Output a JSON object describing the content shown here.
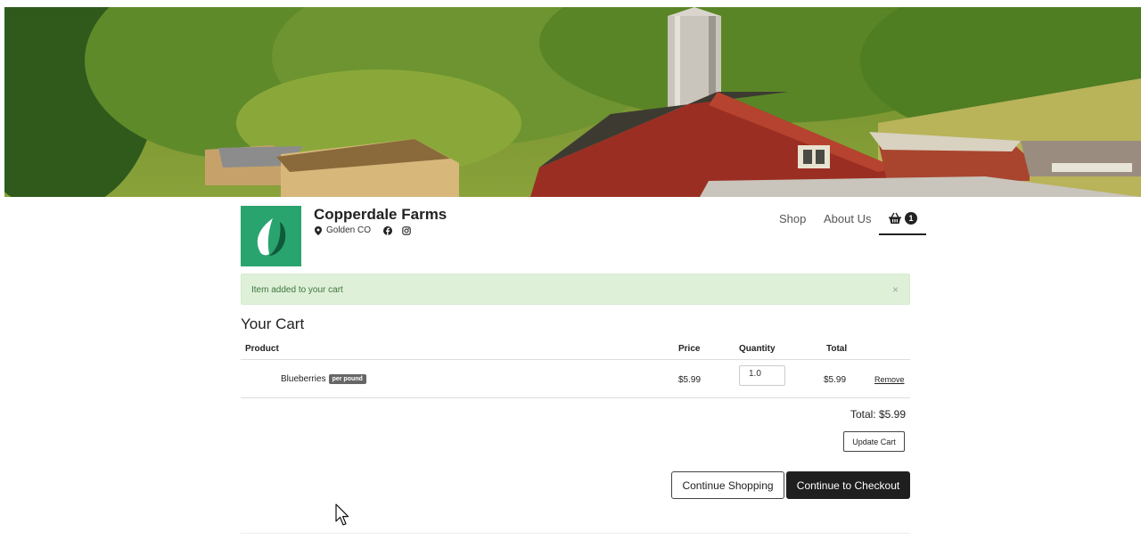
{
  "hero": {
    "image": "farm-barn-banner"
  },
  "header": {
    "farm_name": "Copperdale Farms",
    "location": "Golden CO",
    "icons": [
      "map-pin-icon",
      "facebook-icon",
      "instagram-icon"
    ]
  },
  "nav": {
    "shop": "Shop",
    "about": "About Us",
    "cart_count": "1",
    "cart_icon": "basket-icon"
  },
  "alert": {
    "message": "Item added to your cart",
    "close": "×"
  },
  "cart": {
    "title": "Your Cart",
    "columns": {
      "product": "Product",
      "price": "Price",
      "quantity": "Quantity",
      "total": "Total"
    },
    "items": [
      {
        "name": "Blueberries",
        "unit": "per pound",
        "price": "$5.99",
        "quantity": "1.0",
        "total": "$5.99",
        "remove": "Remove"
      }
    ],
    "grand_total": "Total: $5.99",
    "update_label": "Update Cart",
    "continue_label": "Continue Shopping",
    "checkout_label": "Continue to Checkout"
  },
  "colors": {
    "alert_bg": "#dff0d8",
    "alert_text": "#3c763d",
    "logo_bg": "#2aa46e",
    "primary_button": "#1f1f1f"
  }
}
